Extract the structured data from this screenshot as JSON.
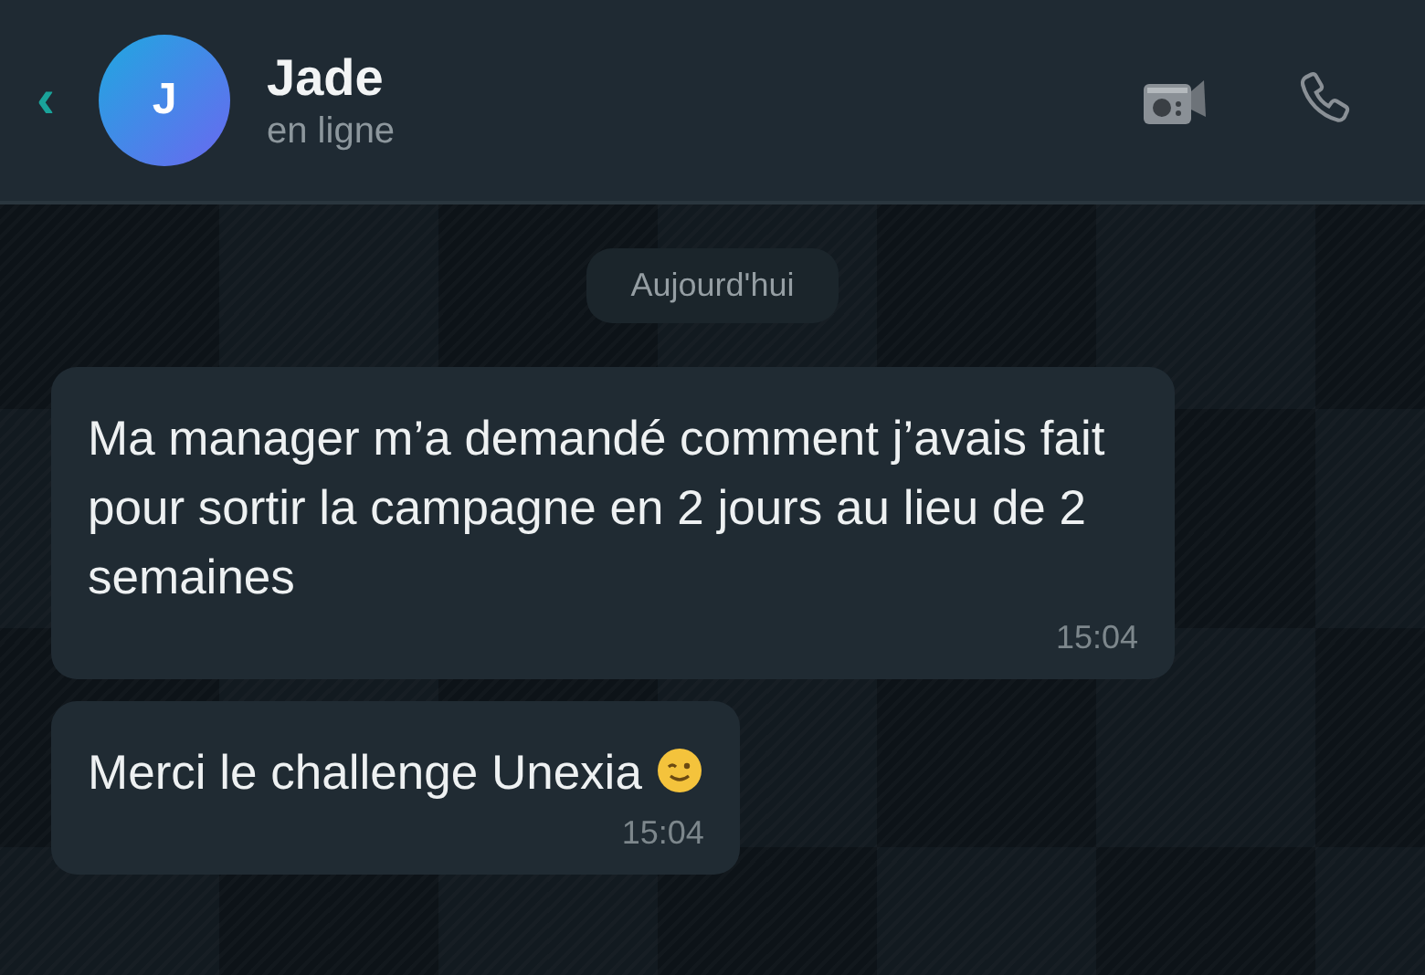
{
  "header": {
    "back": "‹",
    "avatar_letter": "J",
    "name": "Jade",
    "status": "en ligne"
  },
  "date_separator": "Aujourd'hui",
  "messages": [
    {
      "text": "Ma manager m’a demandé comment j’avais fait pour sortir la campagne en 2 jours au lieu de 2 semaines",
      "time": "15:04",
      "emoji": false
    },
    {
      "text": "Merci le challenge Unexia",
      "time": "15:04",
      "emoji": true
    }
  ]
}
